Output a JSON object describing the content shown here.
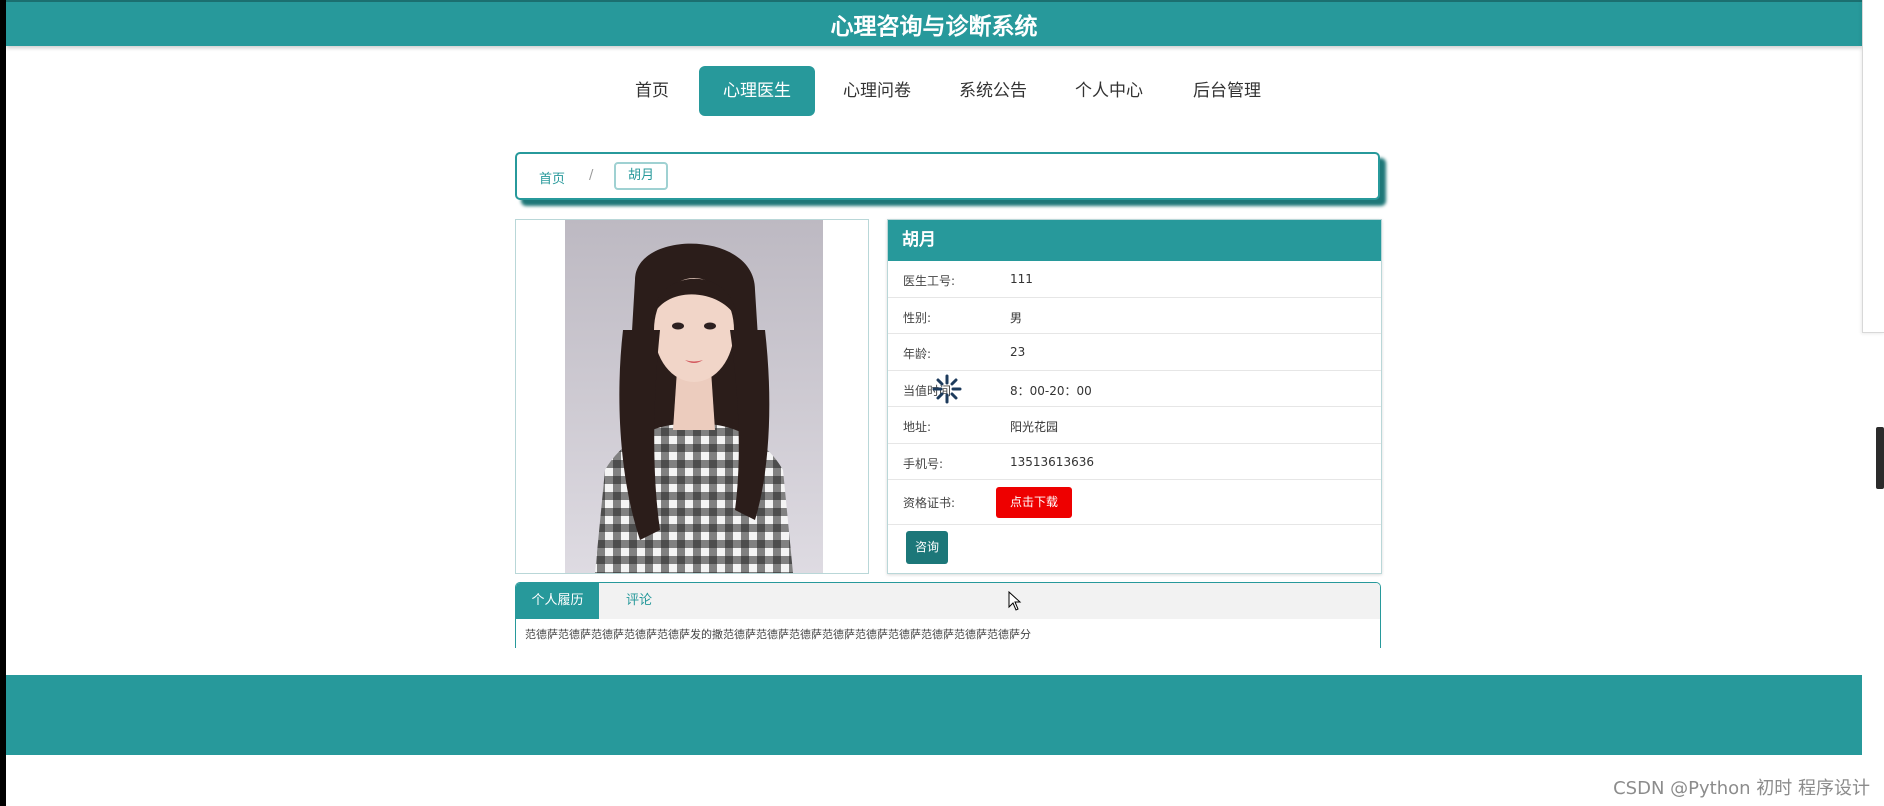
{
  "header": {
    "title": "心理咨询与诊断系统"
  },
  "nav": {
    "items": [
      {
        "label": "首页"
      },
      {
        "label": "心理医生"
      },
      {
        "label": "心理问卷"
      },
      {
        "label": "系统公告"
      },
      {
        "label": "个人中心"
      },
      {
        "label": "后台管理"
      }
    ],
    "active_index": 1
  },
  "breadcrumb": {
    "home": "首页",
    "separator": "/",
    "current": "胡月"
  },
  "doctor": {
    "name": "胡月",
    "fields": [
      {
        "label": "医生工号:",
        "value": "111"
      },
      {
        "label": "性别:",
        "value": "男"
      },
      {
        "label": "年龄:",
        "value": "23"
      },
      {
        "label": "当值时间:",
        "value": "8：00-20：00"
      },
      {
        "label": "地址:",
        "value": "阳光花园"
      },
      {
        "label": "手机号:",
        "value": "13513613636"
      }
    ],
    "certificate_label": "资格证书:",
    "download_label": "点击下载",
    "consult_label": "咨询"
  },
  "tabs": {
    "items": [
      {
        "label": "个人履历"
      },
      {
        "label": "评论"
      }
    ],
    "active_index": 0,
    "content": "范德萨范德萨范德萨范德萨范德萨发的撒范德萨范德萨范德萨范德萨范德萨范德萨范德萨范德萨范德萨分"
  },
  "watermark": "CSDN @Python 初时 程序设计",
  "colors": {
    "primary": "#27999b",
    "primary_dark": "#1c7779",
    "danger": "#ee0000"
  },
  "icons": {
    "loading": "loading-spinner-icon",
    "cursor": "mouse-pointer-icon"
  }
}
